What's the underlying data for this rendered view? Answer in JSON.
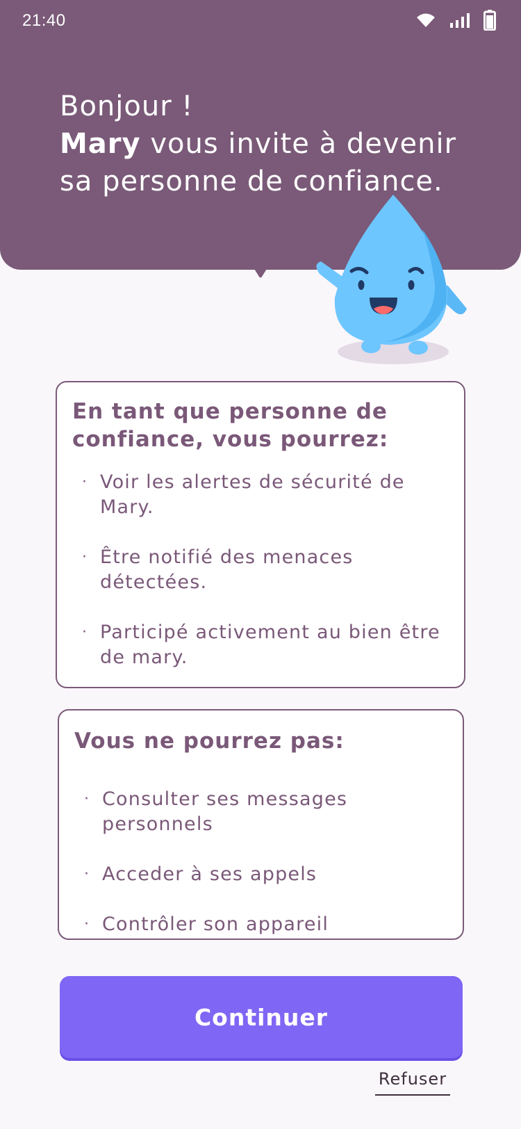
{
  "status_bar": {
    "time": "21:40",
    "icons": [
      "wifi-icon",
      "signal-icon",
      "battery-icon"
    ]
  },
  "header": {
    "greeting_line": "Bonjour !",
    "inviter_name": "Mary",
    "invite_text": " vous invite à devenir sa personne de confiance."
  },
  "can_card": {
    "title": "En tant que personne de confiance, vous pourrez:",
    "items": [
      "Voir les alertes de sécurité de Mary.",
      "Être notifié des menaces détectées.",
      "Participé activement au bien être de mary."
    ]
  },
  "cannot_card": {
    "title": "Vous ne pourrez pas:",
    "items": [
      "Consulter ses messages personnels",
      "Acceder à ses appels",
      "Contrôler son appareil"
    ]
  },
  "actions": {
    "continue_label": "Continuer",
    "refuse_label": "Refuser"
  },
  "colors": {
    "header_bg": "#7a5a78",
    "accent": "#8066f4",
    "mascot_blue": "#6ec6ff",
    "background": "#faf7fb"
  }
}
